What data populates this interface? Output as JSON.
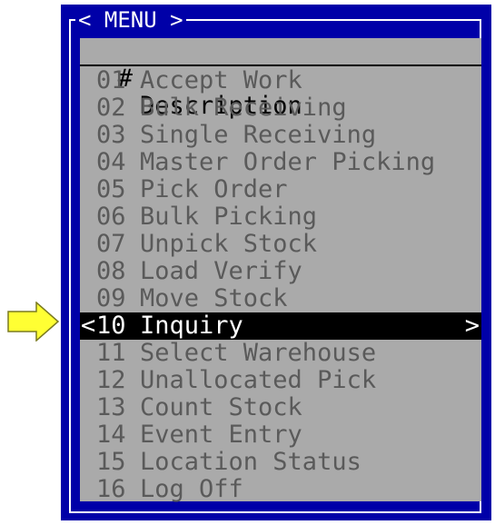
{
  "menu": {
    "title": "< MENU >",
    "header": {
      "num": "#",
      "description": "Description"
    },
    "items": [
      {
        "num": "01",
        "label": "Accept Work"
      },
      {
        "num": "02",
        "label": "Bulk Receiving"
      },
      {
        "num": "03",
        "label": "Single Receiving"
      },
      {
        "num": "04",
        "label": "Master Order Picking"
      },
      {
        "num": "05",
        "label": "Pick Order"
      },
      {
        "num": "06",
        "label": "Bulk Picking"
      },
      {
        "num": "07",
        "label": "Unpick Stock"
      },
      {
        "num": "08",
        "label": "Load Verify"
      },
      {
        "num": "09",
        "label": "Move Stock"
      },
      {
        "num": "10",
        "label": "Inquiry",
        "selected": true,
        "marker_left": "<",
        "marker_right": ">"
      },
      {
        "num": "11",
        "label": "Select Warehouse"
      },
      {
        "num": "12",
        "label": "Unallocated Pick"
      },
      {
        "num": "13",
        "label": "Count Stock"
      },
      {
        "num": "14",
        "label": "Event Entry"
      },
      {
        "num": "15",
        "label": "Location Status"
      },
      {
        "num": "16",
        "label": "Log Off"
      }
    ]
  },
  "colors": {
    "window_bg": "#0000a8",
    "panel_bg": "#aaaaaa",
    "item_text": "#5a5a5a",
    "selected_bg": "#000000",
    "selected_text": "#ffffff",
    "arrow_fill": "#ffff33",
    "arrow_stroke": "#7a7a20"
  },
  "pointer": {
    "icon": "right-arrow-icon"
  }
}
